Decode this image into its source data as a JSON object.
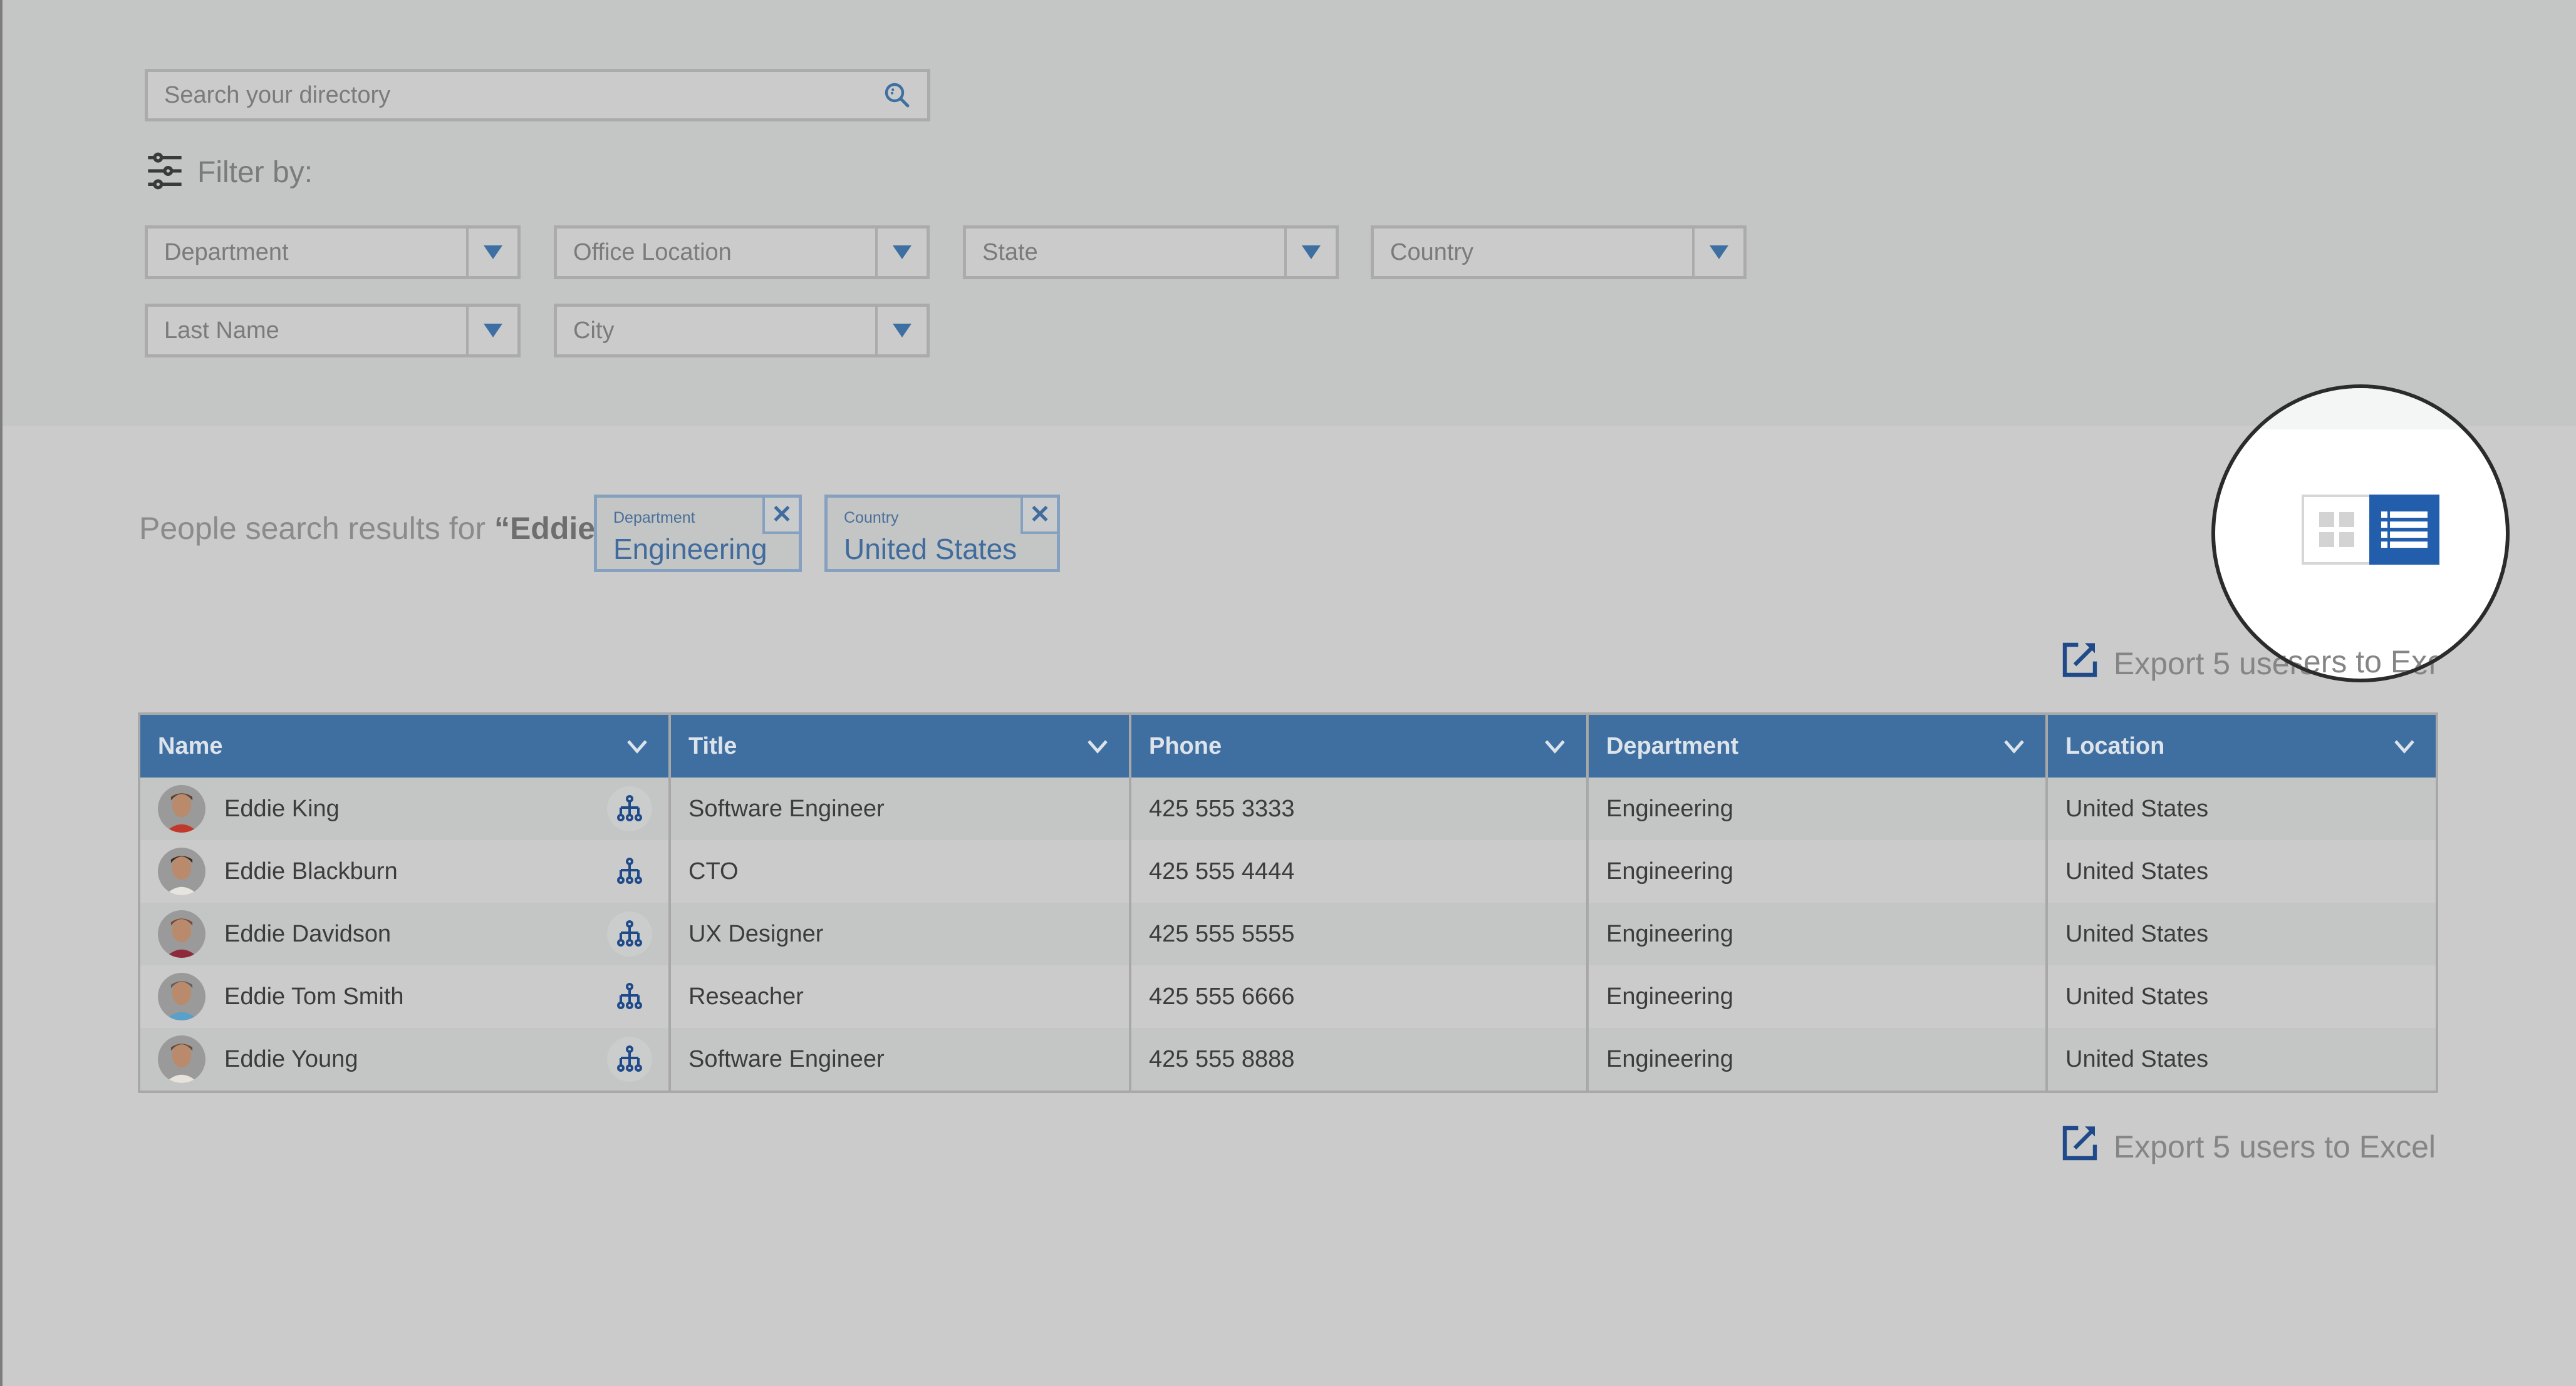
{
  "search": {
    "placeholder": "Search your directory",
    "icon": "search-icon"
  },
  "filters": {
    "label": "Filter by:",
    "icon": "sliders-icon",
    "dropdowns": [
      {
        "label": "Department"
      },
      {
        "label": "Office Location"
      },
      {
        "label": "State"
      },
      {
        "label": "Country"
      },
      {
        "label": "Last Name"
      },
      {
        "label": "City"
      }
    ]
  },
  "results": {
    "prefix": "People search results for ",
    "query": "“Eddie”",
    "chips": [
      {
        "category": "Department",
        "value": "Engineering",
        "remove": "✕"
      },
      {
        "category": "Country",
        "value": "United States",
        "remove": "✕"
      }
    ]
  },
  "view_toggle": {
    "options": [
      "grid-view",
      "list-view"
    ],
    "active": "list-view",
    "active_color": "#235ead"
  },
  "export": {
    "label": "Export 5 users to Excel",
    "icon": "external-link-icon"
  },
  "table": {
    "columns": [
      {
        "label": "Name"
      },
      {
        "label": "Title"
      },
      {
        "label": "Phone"
      },
      {
        "label": "Department"
      },
      {
        "label": "Location"
      }
    ],
    "header_color": "#3e6fa0",
    "rows": [
      {
        "name": "Eddie King",
        "title": "Software Engineer",
        "phone": "425 555 3333",
        "department": "Engineering",
        "location": "United States"
      },
      {
        "name": "Eddie Blackburn",
        "title": "CTO",
        "phone": "425 555 4444",
        "department": "Engineering",
        "location": "United States"
      },
      {
        "name": "Eddie Davidson",
        "title": "UX Designer",
        "phone": "425 555 5555",
        "department": "Engineering",
        "location": "United States"
      },
      {
        "name": "Eddie Tom Smith",
        "title": "Reseacher",
        "phone": "425 555 6666",
        "department": "Engineering",
        "location": "United States"
      },
      {
        "name": "Eddie Young",
        "title": "Software Engineer",
        "phone": "425 555 8888",
        "department": "Engineering",
        "location": "United States"
      }
    ]
  }
}
